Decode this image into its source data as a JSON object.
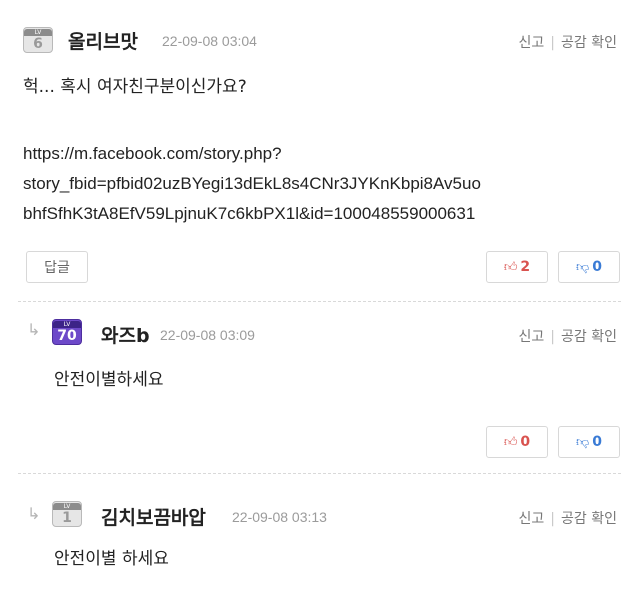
{
  "comments": [
    {
      "level": "6",
      "level_tag": "LV",
      "nickname": "올리브맛",
      "timestamp": "22-09-08 03:04",
      "report_label": "신고",
      "empathy_label": "공감 확인",
      "text": "헉... 혹시 여자친구분이신가요?",
      "link_lines": [
        "https://m.facebook.com/story.php?",
        "story_fbid=pfbid02uzBYegi13dEkL8s4CNr3JYKnKbpi8Av5uo",
        "bhfSfhK3tA8EfV59LpjnuK7c6kbPX1l&id=100048559000631"
      ],
      "reply_label": "답글",
      "likes": "2",
      "dislikes": "0"
    },
    {
      "level": "70",
      "level_tag": "LV",
      "nickname": "와즈b",
      "timestamp": "22-09-08 03:09",
      "report_label": "신고",
      "empathy_label": "공감 확인",
      "text": "안전이별하세요",
      "likes": "0",
      "dislikes": "0"
    },
    {
      "level": "1",
      "level_tag": "LV",
      "nickname": "김치보끔바압",
      "timestamp": "22-09-08 03:13",
      "report_label": "신고",
      "empathy_label": "공감 확인",
      "text": "안전이별 하세요"
    }
  ],
  "icons": {
    "reply_arrow": "reply-arrow-icon",
    "thumb_up": "thumb-up-icon",
    "thumb_down": "thumb-down-icon"
  },
  "colors": {
    "like": "#d9534f",
    "dislike": "#3a7bd5",
    "level_purple": "#6d49c9"
  }
}
